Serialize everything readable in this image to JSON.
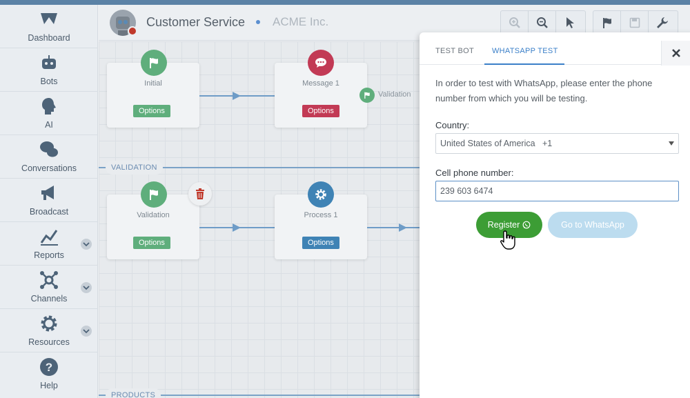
{
  "sidebar": {
    "items": [
      {
        "label": "Dashboard",
        "icon": "dashboard-icon",
        "expandable": false
      },
      {
        "label": "Bots",
        "icon": "bot-icon",
        "expandable": false
      },
      {
        "label": "AI",
        "icon": "ai-head-icon",
        "expandable": false
      },
      {
        "label": "Conversations",
        "icon": "chat-bubbles-icon",
        "expandable": false
      },
      {
        "label": "Broadcast",
        "icon": "megaphone-icon",
        "expandable": false
      },
      {
        "label": "Reports",
        "icon": "line-chart-icon",
        "expandable": true
      },
      {
        "label": "Channels",
        "icon": "network-icon",
        "expandable": true
      },
      {
        "label": "Resources",
        "icon": "gear-icon",
        "expandable": true
      },
      {
        "label": "Help",
        "icon": "help-icon",
        "expandable": false
      }
    ]
  },
  "header": {
    "bot_name": "Customer Service",
    "company": "ACME Inc.",
    "toolbar": [
      "zoom-in-icon",
      "zoom-out-icon",
      "pointer-icon",
      "flag-icon",
      "save-icon",
      "wrench-icon"
    ]
  },
  "canvas": {
    "sections": [
      "VALIDATION",
      "PRODUCTS"
    ],
    "nodes": [
      {
        "title": "Initial",
        "options_label": "Options",
        "color": "#5fae7c"
      },
      {
        "title": "Message 1",
        "options_label": "Options",
        "color": "#c23a55"
      },
      {
        "title": "Validation",
        "options_label": "Options",
        "color": "#5fae7c"
      },
      {
        "title": "Process 1",
        "options_label": "Options",
        "color": "#3f83b5"
      }
    ],
    "branch_label": "Validation"
  },
  "panel": {
    "tabs": [
      {
        "label": "TEST BOT",
        "active": false
      },
      {
        "label": "WHATSAPP TEST",
        "active": true
      }
    ],
    "intro": "In order to test with WhatsApp, please enter the phone number from which you will be testing.",
    "country_label": "Country:",
    "country_value": "United States of America   +1",
    "phone_label": "Cell phone number:",
    "phone_value": "239 603 6474",
    "register_label": "Register",
    "whatsapp_label": "Go to WhatsApp"
  },
  "colors": {
    "accent": "#3a7fc8",
    "register": "#3c9d35",
    "whatsapp_disabled": "#bcdcef"
  }
}
